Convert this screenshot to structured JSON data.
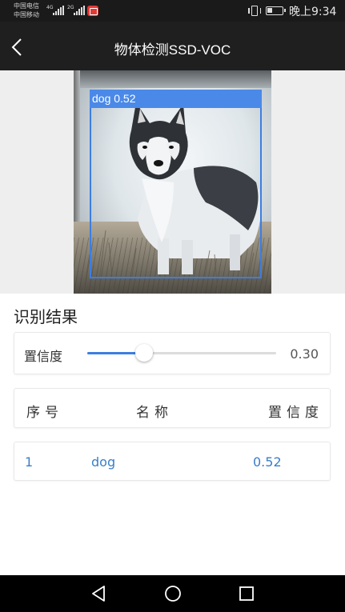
{
  "status_bar": {
    "carrier_1": "中国电信",
    "carrier_2": "中国移动",
    "network_1": "4G",
    "network_2": "2G",
    "time": "晚上9:34"
  },
  "header": {
    "title": "物体检测SSD-VOC",
    "back_icon": "back-arrow-icon"
  },
  "image": {
    "subject": "dog",
    "detection": {
      "label": "dog 0.52",
      "box_color": "#3d7ee0"
    }
  },
  "results": {
    "title": "识别结果",
    "confidence_label": "置信度",
    "confidence_value": "0.30",
    "confidence_fraction": 0.3,
    "columns": [
      "序号",
      "名称",
      "置信度"
    ],
    "rows": [
      {
        "index": "1",
        "name": "dog",
        "confidence": "0.52"
      }
    ]
  },
  "nav_bar": {
    "back_icon": "triangle-back-icon",
    "home_icon": "circle-home-icon",
    "recent_icon": "square-recent-icon"
  },
  "colors": {
    "accent": "#3d7ee0",
    "header_bg": "#1f1f1f",
    "row_text": "#3a7ec8"
  }
}
